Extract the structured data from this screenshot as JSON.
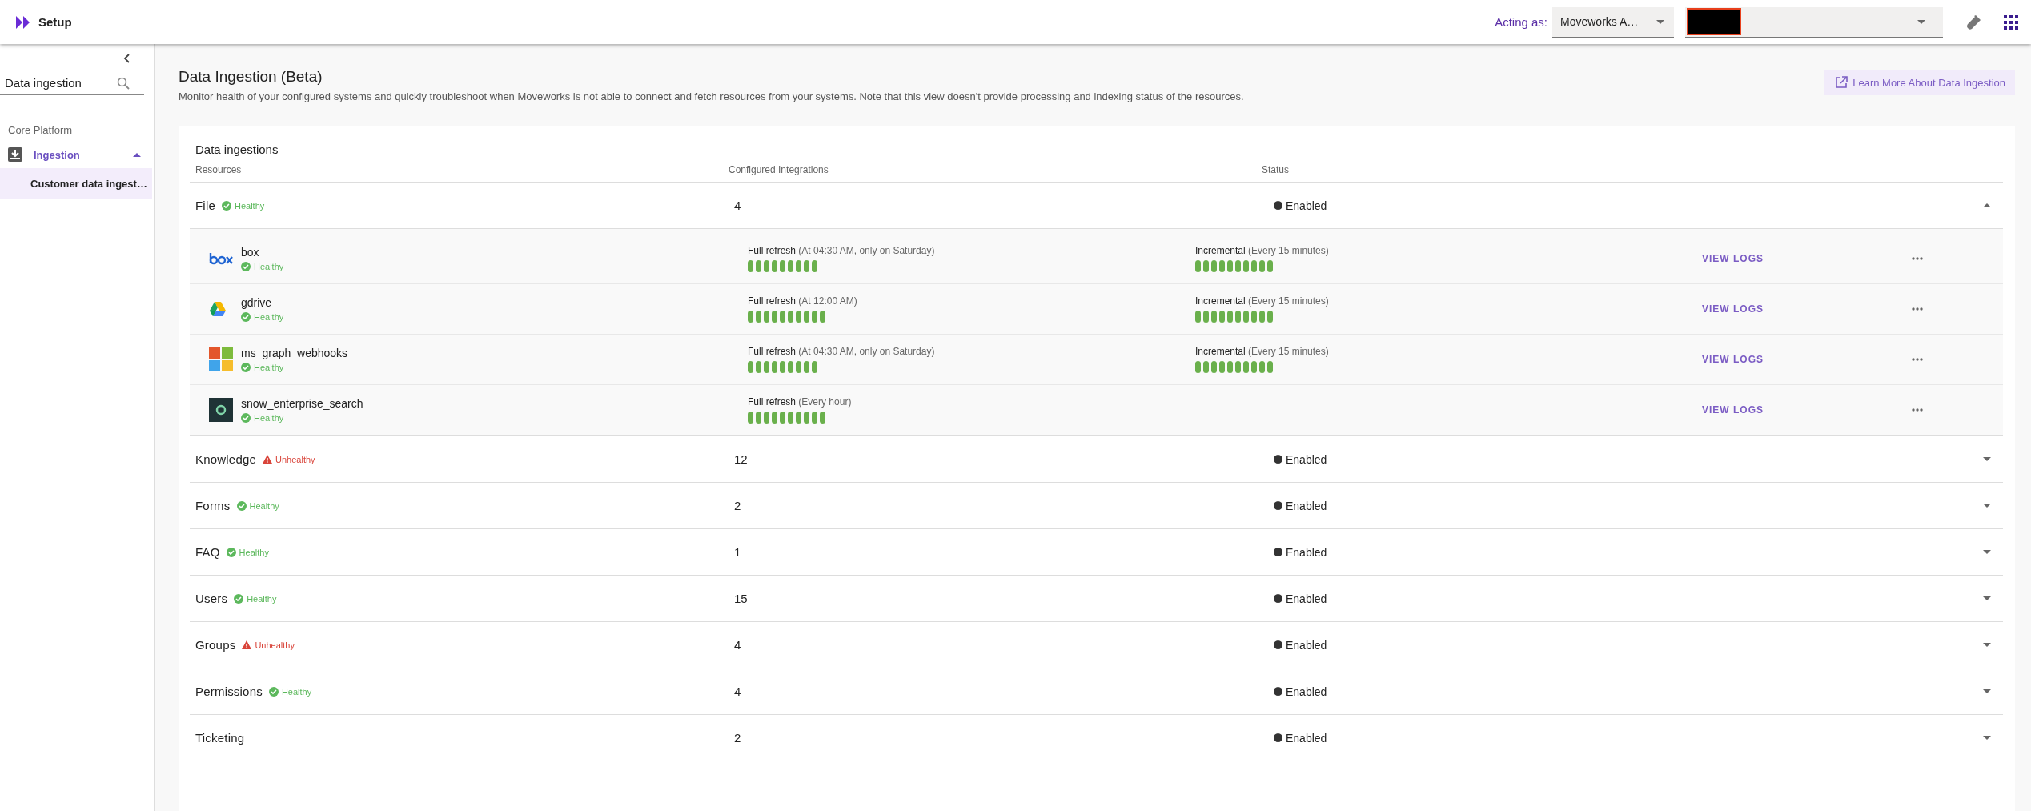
{
  "app": {
    "title": "Setup"
  },
  "header": {
    "acting_as_label": "Acting as:",
    "account_select": {
      "value": "Moveworks A…"
    }
  },
  "sidebar": {
    "search": {
      "value": "Data ingestion"
    },
    "section": "Core Platform",
    "items": [
      {
        "label": "Ingestion",
        "expanded": true,
        "children": [
          {
            "label": "Customer data ingest…",
            "selected": true
          }
        ]
      }
    ]
  },
  "page": {
    "title": "Data Ingestion (Beta)",
    "description": "Monitor health of your configured systems and quickly troubleshoot when Moveworks is not able to connect and fetch resources from your systems. Note that this view doesn't provide processing and indexing status of the resources.",
    "learn_more": "Learn More About Data Ingestion"
  },
  "table": {
    "title": "Data ingestions",
    "columns": [
      "Resources",
      "Configured Integrations",
      "Status"
    ],
    "rows": [
      {
        "resource": "File",
        "health": {
          "kind": "healthy",
          "label": "Healthy"
        },
        "count": "4",
        "status": "Enabled",
        "expanded": true,
        "integrations": [
          {
            "name": "box",
            "kind": "box",
            "health": {
              "kind": "healthy",
              "label": "Healthy"
            },
            "full_refresh": {
              "label": "Full refresh",
              "detail": "(At 04:30 AM, only on Saturday)",
              "runs": [
                {
                  "ok": true
                },
                {
                  "ok": true
                },
                {
                  "ok": true
                },
                {
                  "ok": true
                },
                {
                  "ok": true
                },
                {
                  "ok": true
                },
                {
                  "ok": true
                },
                {
                  "ok": true
                },
                {
                  "ok": true
                }
              ]
            },
            "incremental": {
              "label": "Incremental",
              "detail": "(Every 15 minutes)",
              "runs": [
                {
                  "ok": true
                },
                {
                  "ok": true
                },
                {
                  "ok": true
                },
                {
                  "ok": true
                },
                {
                  "ok": true
                },
                {
                  "ok": true
                },
                {
                  "ok": true
                },
                {
                  "ok": true
                },
                {
                  "ok": true
                },
                {
                  "ok": true
                }
              ]
            },
            "action": "VIEW LOGS"
          },
          {
            "name": "gdrive",
            "kind": "drive",
            "health": {
              "kind": "healthy",
              "label": "Healthy"
            },
            "full_refresh": {
              "label": "Full refresh",
              "detail": "(At 12:00 AM)",
              "runs": [
                {
                  "ok": true
                },
                {
                  "ok": true
                },
                {
                  "ok": true
                },
                {
                  "ok": true
                },
                {
                  "ok": true
                },
                {
                  "ok": true
                },
                {
                  "ok": true
                },
                {
                  "ok": true
                },
                {
                  "ok": true
                },
                {
                  "ok": true
                }
              ]
            },
            "incremental": {
              "label": "Incremental",
              "detail": "(Every 15 minutes)",
              "runs": [
                {
                  "ok": true
                },
                {
                  "ok": true
                },
                {
                  "ok": true
                },
                {
                  "ok": true
                },
                {
                  "ok": true
                },
                {
                  "ok": true
                },
                {
                  "ok": true
                },
                {
                  "ok": true
                },
                {
                  "ok": true
                },
                {
                  "ok": true
                }
              ]
            },
            "action": "VIEW LOGS"
          },
          {
            "name": "ms_graph_webhooks",
            "kind": "windows",
            "health": {
              "kind": "healthy",
              "label": "Healthy"
            },
            "full_refresh": {
              "label": "Full refresh",
              "detail": "(At 04:30 AM, only on Saturday)",
              "runs": [
                {
                  "ok": true
                },
                {
                  "ok": true
                },
                {
                  "ok": true
                },
                {
                  "ok": true
                },
                {
                  "ok": true
                },
                {
                  "ok": true
                },
                {
                  "ok": true
                },
                {
                  "ok": true
                },
                {
                  "ok": true
                }
              ]
            },
            "incremental": {
              "label": "Incremental",
              "detail": "(Every 15 minutes)",
              "runs": [
                {
                  "ok": true
                },
                {
                  "ok": true
                },
                {
                  "ok": true
                },
                {
                  "ok": true
                },
                {
                  "ok": true
                },
                {
                  "ok": true
                },
                {
                  "ok": true
                },
                {
                  "ok": true
                },
                {
                  "ok": true
                },
                {
                  "ok": true
                }
              ]
            },
            "action": "VIEW LOGS"
          },
          {
            "name": "snow_enterprise_search",
            "kind": "now",
            "health": {
              "kind": "healthy",
              "label": "Healthy"
            },
            "full_refresh": {
              "label": "Full refresh",
              "detail": "(Every hour)",
              "runs": [
                {
                  "ok": true
                },
                {
                  "ok": true
                },
                {
                  "ok": true
                },
                {
                  "ok": true
                },
                {
                  "ok": true
                },
                {
                  "ok": true
                },
                {
                  "ok": true
                },
                {
                  "ok": true
                },
                {
                  "ok": true
                },
                {
                  "ok": true
                }
              ]
            },
            "action": "VIEW LOGS"
          }
        ]
      },
      {
        "resource": "Knowledge",
        "health": {
          "kind": "unhealthy",
          "label": "Unhealthy"
        },
        "count": "12",
        "status": "Enabled",
        "expanded": false
      },
      {
        "resource": "Forms",
        "health": {
          "kind": "healthy",
          "label": "Healthy"
        },
        "count": "2",
        "status": "Enabled",
        "expanded": false
      },
      {
        "resource": "FAQ",
        "health": {
          "kind": "healthy",
          "label": "Healthy"
        },
        "count": "1",
        "status": "Enabled",
        "expanded": false
      },
      {
        "resource": "Users",
        "health": {
          "kind": "healthy",
          "label": "Healthy"
        },
        "count": "15",
        "status": "Enabled",
        "expanded": false
      },
      {
        "resource": "Groups",
        "health": {
          "kind": "unhealthy",
          "label": "Unhealthy"
        },
        "count": "4",
        "status": "Enabled",
        "expanded": false
      },
      {
        "resource": "Permissions",
        "health": {
          "kind": "healthy",
          "label": "Healthy"
        },
        "count": "4",
        "status": "Enabled",
        "expanded": false
      },
      {
        "resource": "Ticketing",
        "count": "2",
        "status": "Enabled",
        "expanded": false
      }
    ]
  }
}
